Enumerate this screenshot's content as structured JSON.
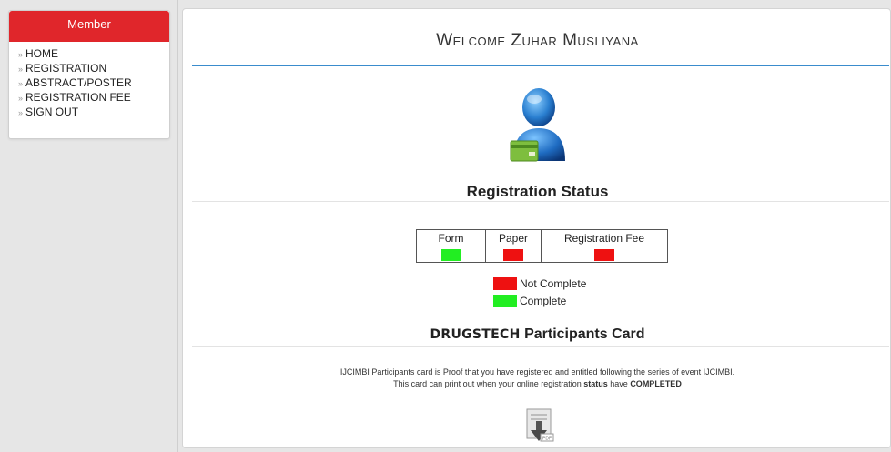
{
  "sidebar": {
    "header": "Member",
    "items": [
      {
        "label": "HOME"
      },
      {
        "label": "REGISTRATION"
      },
      {
        "label": "ABSTRACT/POSTER"
      },
      {
        "label": "REGISTRATION FEE"
      },
      {
        "label": "SIGN OUT"
      }
    ]
  },
  "main": {
    "welcome": "Welcome Zuhar Musliyana",
    "status_title": "Registration Status",
    "status_table": {
      "headers": [
        "Form",
        "Paper",
        "Registration Fee"
      ],
      "statuses": [
        "complete",
        "not_complete",
        "not_complete"
      ]
    },
    "legend": {
      "not_complete": "Not Complete",
      "complete": "Complete"
    },
    "card": {
      "brand": "DRUGSTECH",
      "title": "Participants Card",
      "desc_line1": "IJCIMBI Participants card is Proof that you have registered and entitled following the series of event IJCIMBI.",
      "desc_line2_a": "This card can print out when your online registration ",
      "desc_line2_b": "status",
      "desc_line2_c": " have ",
      "desc_line2_d": "COMPLETED"
    }
  },
  "colors": {
    "accent_red": "#e0262b",
    "complete": "#22ee22",
    "not_complete": "#ee1111",
    "rule_blue": "#3a8ccd"
  },
  "icons": {
    "avatar": "user-avatar-icon",
    "download": "pdf-download-icon"
  }
}
